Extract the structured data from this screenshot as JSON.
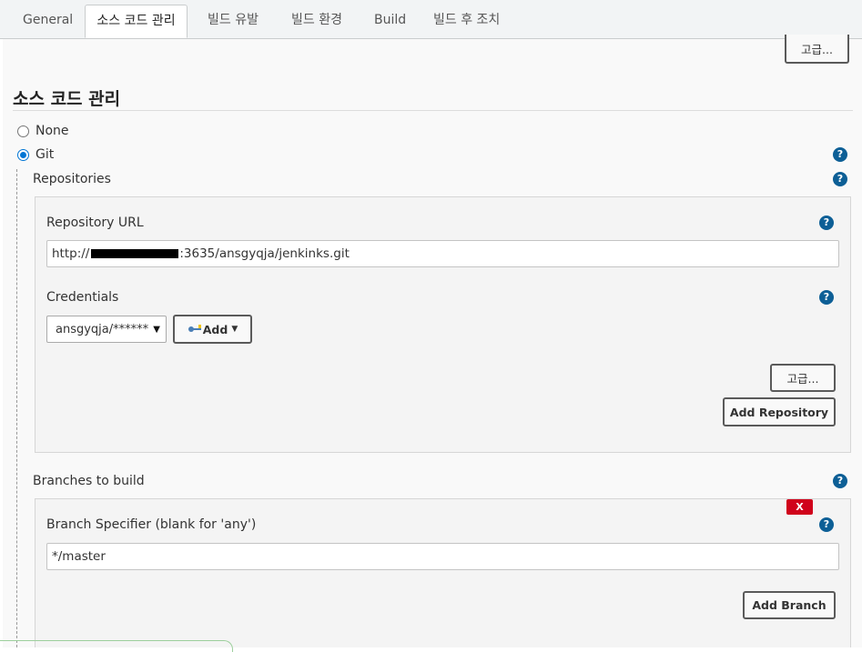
{
  "tabs": [
    {
      "label": "General"
    },
    {
      "label": "소스 코드 관리",
      "active": true
    },
    {
      "label": "빌드 유발"
    },
    {
      "label": "빌드 환경"
    },
    {
      "label": "Build"
    },
    {
      "label": "빌드 후 조치"
    }
  ],
  "top_advanced_label": "고급...",
  "section": {
    "title": "소스 코드 관리"
  },
  "scm": {
    "options": [
      {
        "label": "None",
        "checked": false
      },
      {
        "label": "Git",
        "checked": true
      }
    ],
    "help_icon": "?"
  },
  "repositories": {
    "label": "Repositories",
    "url_label": "Repository URL",
    "url_prefix": "http://",
    "url_suffix": ":3635/ansgyqja/jenkinks.git",
    "credentials_label": "Credentials",
    "credentials_selected": "ansgyqja/******",
    "add_label": "Add",
    "advanced_label": "고급...",
    "add_repository_label": "Add Repository"
  },
  "branches": {
    "label": "Branches to build",
    "delete_label": "X",
    "specifier_label": "Branch Specifier (blank for 'any')",
    "specifier_value": "*/master",
    "add_branch_label": "Add Branch"
  },
  "colors": {
    "help_icon": "#0d5f96",
    "radio_checked": "#0075d4",
    "delete_button": "#d0021b"
  }
}
